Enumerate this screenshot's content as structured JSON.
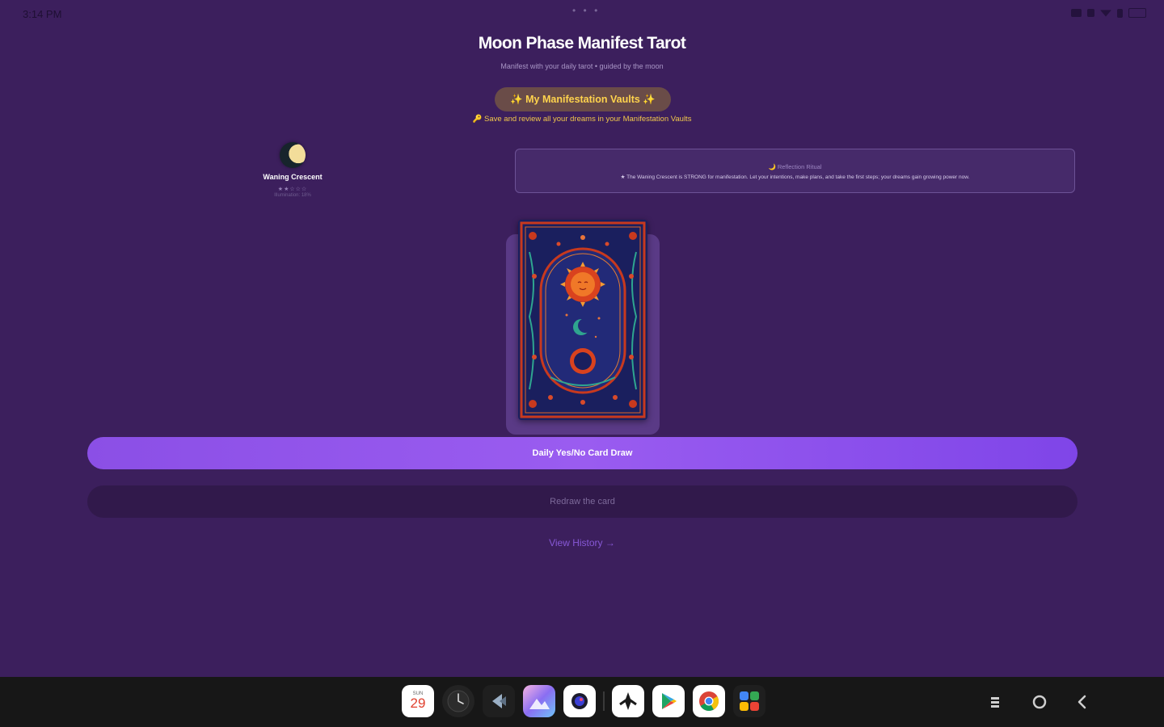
{
  "status_bar": {
    "time": "3:14 PM",
    "dots": "• • •",
    "icons": [
      "notification-icon",
      "notification-icon",
      "wifi-icon",
      "bluetooth-icon",
      "battery-icon"
    ]
  },
  "header": {
    "title": "Moon Phase Manifest Tarot",
    "subtitle": "Manifest with your daily tarot • guided by the moon"
  },
  "vault": {
    "button_label": "✨ My Manifestation Vaults ✨",
    "hint": "🔑 Save and review all your dreams in your Manifestation Vaults"
  },
  "moon": {
    "phase_name": "Waning Crescent",
    "rating": "★★☆☆☆",
    "illumination": "Illumination: 18%"
  },
  "reflection": {
    "title": "🌙 Reflection Ritual",
    "text": "★ The Waning Crescent is STRONG for manifestation. Let your intentions, make plans, and take the first steps; your dreams gain growing power now."
  },
  "card": {
    "description": "tarot card back with sun and moon design"
  },
  "actions": {
    "draw_label": "Daily Yes/No Card Draw",
    "redraw_label": "Redraw the card",
    "history_label": "View History →"
  },
  "taskbar": {
    "calendar_day": "29",
    "calendar_weekday": "SUN",
    "apps": [
      "calendar-app-icon",
      "clock-app-icon",
      "files-app-icon",
      "gallery-app-icon",
      "camera-app-icon",
      "tips-app-icon",
      "play-store-icon",
      "chrome-icon",
      "all-apps-icon"
    ],
    "nav": [
      "recents-icon",
      "home-icon",
      "back-icon"
    ]
  },
  "colors": {
    "background": "#3c1f5d",
    "accent": "#8b4fe6",
    "gold": "#ffd34d",
    "vault_bg": "#6a4c48",
    "taskbar": "#171717"
  }
}
